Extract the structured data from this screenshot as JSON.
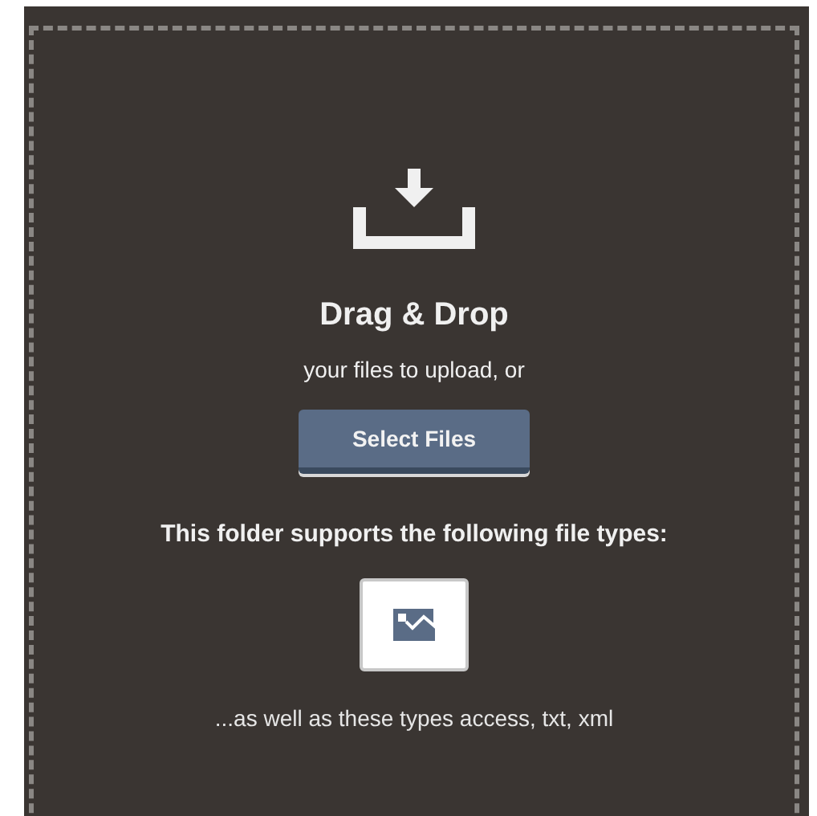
{
  "drop_zone": {
    "title": "Drag & Drop",
    "subtitle": "your files to upload, or",
    "button": "Select Files",
    "supported_label": "This folder supports the following file types:",
    "file_types": [
      {
        "kind": "image"
      }
    ],
    "other_types": "...as well as these types access, txt, xml"
  }
}
